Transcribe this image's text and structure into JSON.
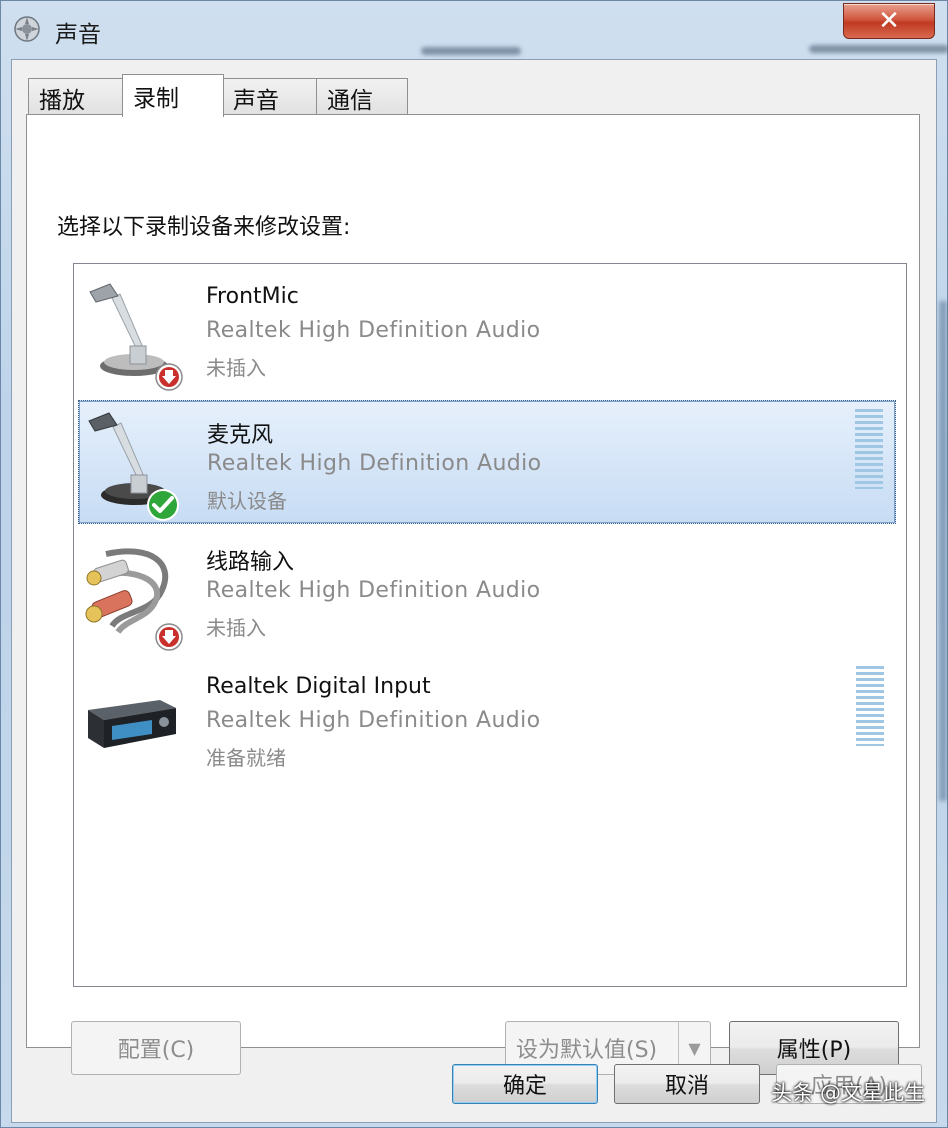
{
  "window": {
    "title": "声音",
    "close_glyph": "✕"
  },
  "tabs": [
    {
      "label": "播放"
    },
    {
      "label": "录制"
    },
    {
      "label": "声音"
    },
    {
      "label": "通信"
    }
  ],
  "instruction": "选择以下录制设备来修改设置:",
  "devices": [
    {
      "name": "FrontMic",
      "driver": "Realtek High Definition Audio",
      "status": "未插入",
      "icon": "microphone-icon",
      "badge": "unplugged-arrow-icon"
    },
    {
      "name": "麦克风",
      "driver": "Realtek High Definition Audio",
      "status": "默认设备",
      "icon": "microphone-icon",
      "badge": "default-check-icon"
    },
    {
      "name": "线路输入",
      "driver": "Realtek High Definition Audio",
      "status": "未插入",
      "icon": "line-in-cable-icon",
      "badge": "unplugged-arrow-icon"
    },
    {
      "name": "Realtek Digital Input",
      "driver": "Realtek High Definition Audio",
      "status": "准备就绪",
      "icon": "digital-receiver-icon"
    }
  ],
  "buttons": {
    "configure": "配置(C)",
    "set_default": "设为默认值(S)",
    "properties": "属性(P)",
    "ok": "确定",
    "cancel": "取消",
    "apply": "应用(A)"
  },
  "watermark": "头条 @文星此生"
}
